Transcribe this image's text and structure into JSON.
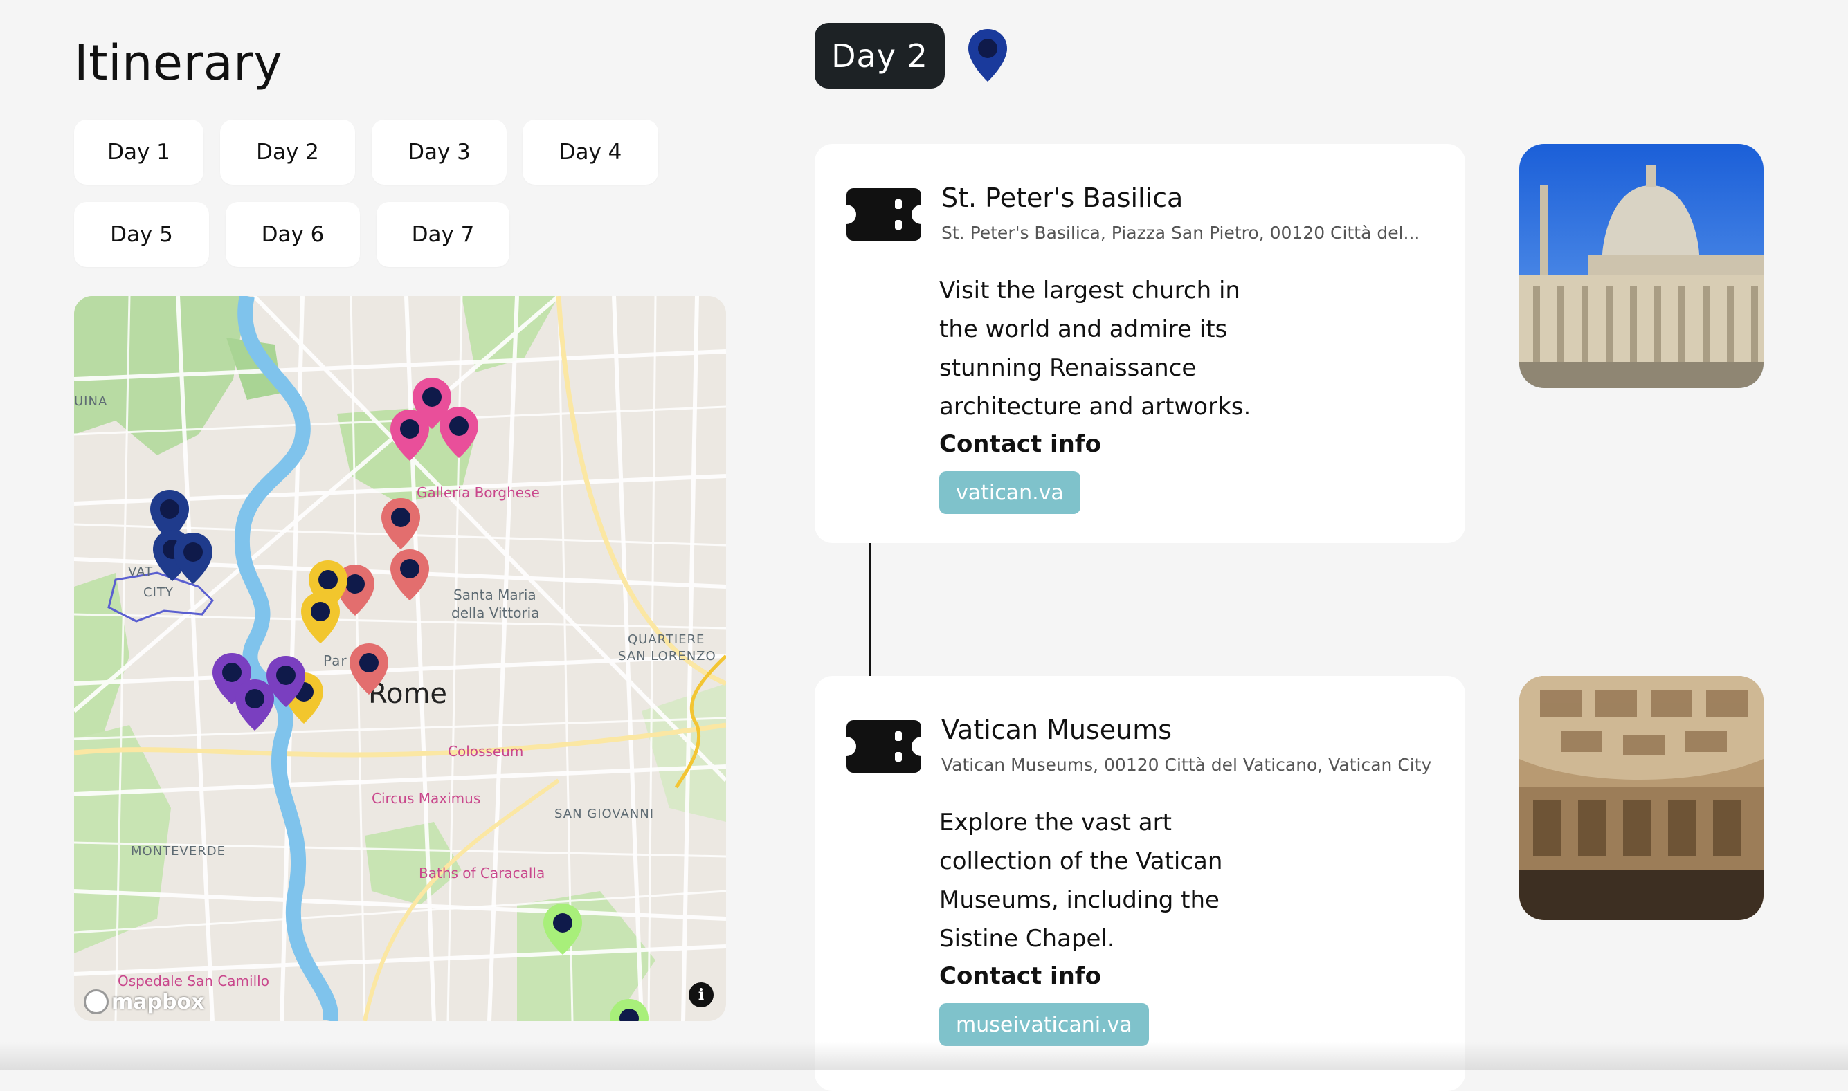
{
  "page": {
    "title": "Itinerary"
  },
  "day_tabs": [
    {
      "label": "Day 1"
    },
    {
      "label": "Day 2"
    },
    {
      "label": "Day 3"
    },
    {
      "label": "Day 4"
    },
    {
      "label": "Day 5"
    },
    {
      "label": "Day 6"
    },
    {
      "label": "Day 7"
    }
  ],
  "map": {
    "labels": {
      "galleria": "Galleria Borghese",
      "santa_maria": "Santa Maria",
      "della_vittoria": "della Vittoria",
      "quartiere": "QUARTIERE",
      "san_lorenzo": "SAN LORENZO",
      "rome": "Rome",
      "colosseum": "Colosseum",
      "circus": "Circus Maximus",
      "san_giovanni": "SAN GIOVANNI",
      "monteverde": "MONTEVERDE",
      "baths": "Baths of Caracalla",
      "ospedale": "Ospedale San Camillo",
      "vatican": "VAT",
      "city": "CITY",
      "pantheon": "Par",
      "quina": "UINA"
    },
    "attribution": "mapbox",
    "info_icon": "i",
    "pin_colors": {
      "day1": "#1f3b8c",
      "day2": "#e36e6e",
      "day3": "#e94f9a",
      "day4": "#f2c62d",
      "day5": "#7a3fc0",
      "day6": "#a8ef7a"
    }
  },
  "detail": {
    "day_label": "Day 2",
    "pin_color": "#1a3a9c",
    "items": [
      {
        "title": "St. Peter's Basilica",
        "address": "St. Peter's Basilica, Piazza San Pietro, 00120 Città del...",
        "description": "Visit the largest church in the world and admire its stunning Renaissance architecture and artworks.",
        "contact_label": "Contact info",
        "link": "vatican.va"
      },
      {
        "title": "Vatican Museums",
        "address": "Vatican Museums, 00120 Città del Vaticano, Vatican City",
        "description": "Explore the vast art collection of the Vatican Museums, including the Sistine Chapel.",
        "contact_label": "Contact info",
        "link": "museivaticani.va"
      }
    ]
  }
}
